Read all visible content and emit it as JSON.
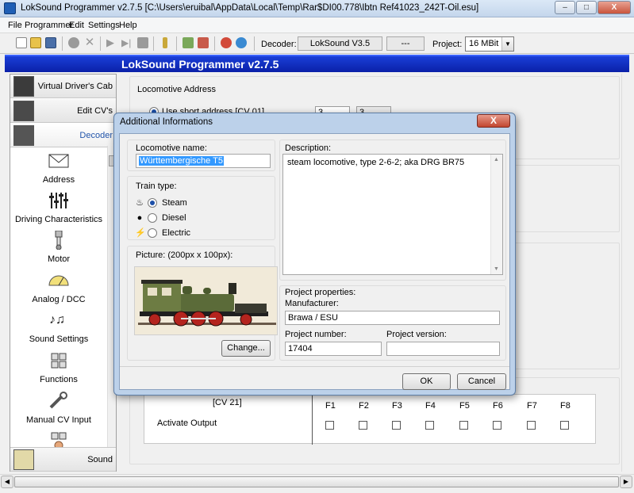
{
  "window": {
    "title": "LokSound Programmer  v2.7.5  [C:\\Users\\eruibal\\AppData\\Local\\Temp\\Rar$DI00.778\\Ibtn Ref41023_242T-Oil.esu]",
    "btn_min": "–",
    "btn_max": "□",
    "btn_close": "X"
  },
  "menu": [
    "File",
    "Programmer",
    "Edit",
    "Settings",
    "Help"
  ],
  "toolbar": {
    "decoder_label": "Decoder:",
    "decoder_value": "LokSound V3.5",
    "decoder_extra": "---",
    "project_label": "Project:",
    "project_value": "16 MBit"
  },
  "header_title": "LokSound Programmer  v2.7.5",
  "sidebar": {
    "top_items": [
      "Virtual Driver's Cab",
      "Edit CV's",
      "Decoder"
    ],
    "items": [
      "Address",
      "Driving Characteristics",
      "Motor",
      "Analog / DCC",
      "Sound Settings",
      "Functions",
      "Manual CV Input"
    ],
    "bottom_item": "Sound"
  },
  "background": {
    "section_title": "Locomotive Address",
    "short_address_label": "Use short address [CV 01]",
    "short_address_value": "3",
    "short_address_value2": "3",
    "cv21_label": "[CV 21]",
    "activate_output_label": "Activate Output",
    "functions": [
      "F1",
      "F2",
      "F3",
      "F4",
      "F5",
      "F6",
      "F7",
      "F8"
    ]
  },
  "dialog": {
    "title": "Additional Informations",
    "close": "X",
    "loco_name_label": "Locomotive name:",
    "loco_name_value": "Württembergische T5",
    "train_type_label": "Train type:",
    "train_types": [
      "Steam",
      "Diesel",
      "Electric"
    ],
    "train_type_selected": "Steam",
    "picture_label": "Picture: (200px x 100px):",
    "change_button": "Change...",
    "description_label": "Description:",
    "description_value": "steam locomotive, type 2-6-2; aka DRG BR75",
    "project_props_label": "Project properties:",
    "manufacturer_label": "Manufacturer:",
    "manufacturer_value": "Brawa / ESU",
    "project_number_label": "Project number:",
    "project_number_value": "17404",
    "project_version_label": "Project version:",
    "project_version_value": "",
    "ok_button": "OK",
    "cancel_button": "Cancel"
  },
  "colors": {
    "header_blue": "#0a20a8",
    "selection_blue": "#3399ff",
    "loco_green": "#5f6e3a",
    "wheel_red": "#b4241e"
  }
}
